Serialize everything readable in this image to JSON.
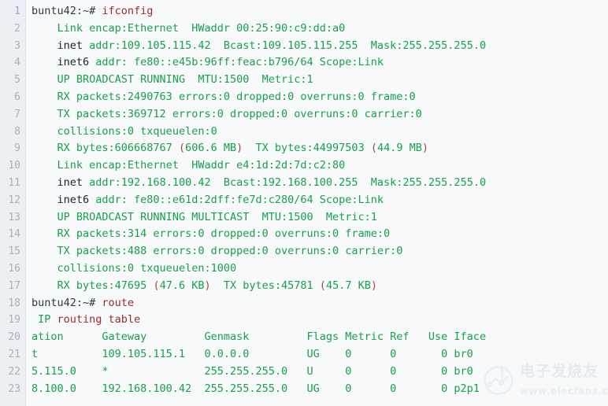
{
  "terminal": {
    "gutter_label": "line-numbers",
    "first_line_number": 1,
    "last_line_number": 23,
    "colors": {
      "background": "#f7f9fa",
      "gutter_background": "#eceff4",
      "line_number": "#a9b1ba",
      "output_green": "#19a04b",
      "keyword_dark": "#16242e",
      "command_red": "#9c2a2a",
      "paren_red": "#9c4a3a"
    },
    "lines": [
      {
        "n": 1,
        "tokens": [
          {
            "t": "buntu42:~# ",
            "c": "pr"
          },
          {
            "t": "ifconfig",
            "c": "cmd"
          }
        ]
      },
      {
        "n": 2,
        "tokens": [
          {
            "t": "    ",
            "c": "g"
          },
          {
            "t": "Link encap:Ethernet  HWaddr 00:25:90:c9:dd:a0",
            "c": "g"
          }
        ]
      },
      {
        "n": 3,
        "tokens": [
          {
            "t": "    ",
            "c": "g"
          },
          {
            "t": "inet",
            "c": "dk"
          },
          {
            "t": " addr:109.105.115.42  Bcast:109.105.115.255  Mask:255.255.255.0",
            "c": "g"
          }
        ]
      },
      {
        "n": 4,
        "tokens": [
          {
            "t": "    ",
            "c": "g"
          },
          {
            "t": "inet6",
            "c": "dk"
          },
          {
            "t": " addr: fe80::e45b:96ff:feac:b796/64 Scope:Link",
            "c": "g"
          }
        ]
      },
      {
        "n": 5,
        "tokens": [
          {
            "t": "    ",
            "c": "g"
          },
          {
            "t": "UP BROADCAST RUNNING  MTU:1500  Metric:1",
            "c": "g"
          }
        ]
      },
      {
        "n": 6,
        "tokens": [
          {
            "t": "    ",
            "c": "g"
          },
          {
            "t": "RX packets:2490763 errors:0 dropped:0 overruns:0 frame:0",
            "c": "g"
          }
        ]
      },
      {
        "n": 7,
        "tokens": [
          {
            "t": "    ",
            "c": "g"
          },
          {
            "t": "TX packets:369712 errors:0 dropped:0 overruns:0 carrier:0",
            "c": "g"
          }
        ]
      },
      {
        "n": 8,
        "tokens": [
          {
            "t": "    ",
            "c": "g"
          },
          {
            "t": "collisions:0 txqueuelen:0",
            "c": "g"
          }
        ]
      },
      {
        "n": 9,
        "tokens": [
          {
            "t": "    ",
            "c": "g"
          },
          {
            "t": "RX bytes:606668767 ",
            "c": "g"
          },
          {
            "t": "(",
            "c": "pn"
          },
          {
            "t": "606.6 MB",
            "c": "g"
          },
          {
            "t": ")",
            "c": "pn"
          },
          {
            "t": "  TX bytes:44997503 ",
            "c": "g"
          },
          {
            "t": "(",
            "c": "pn"
          },
          {
            "t": "44.9 MB",
            "c": "g"
          },
          {
            "t": ")",
            "c": "pn"
          }
        ]
      },
      {
        "n": 10,
        "tokens": [
          {
            "t": "    ",
            "c": "g"
          },
          {
            "t": "Link encap:Ethernet  HWaddr e4:1d:2d:7d:c2:80",
            "c": "g"
          }
        ]
      },
      {
        "n": 11,
        "tokens": [
          {
            "t": "    ",
            "c": "g"
          },
          {
            "t": "inet",
            "c": "dk"
          },
          {
            "t": " addr:192.168.100.42  Bcast:192.168.100.255  Mask:255.255.255.0",
            "c": "g"
          }
        ]
      },
      {
        "n": 12,
        "tokens": [
          {
            "t": "    ",
            "c": "g"
          },
          {
            "t": "inet6",
            "c": "dk"
          },
          {
            "t": " addr: fe80::e61d:2dff:fe7d:c280/64 Scope:Link",
            "c": "g"
          }
        ]
      },
      {
        "n": 13,
        "tokens": [
          {
            "t": "    ",
            "c": "g"
          },
          {
            "t": "UP BROADCAST RUNNING MULTICAST  MTU:1500  Metric:1",
            "c": "g"
          }
        ]
      },
      {
        "n": 14,
        "tokens": [
          {
            "t": "    ",
            "c": "g"
          },
          {
            "t": "RX packets:314 errors:0 dropped:0 overruns:0 frame:0",
            "c": "g"
          }
        ]
      },
      {
        "n": 15,
        "tokens": [
          {
            "t": "    ",
            "c": "g"
          },
          {
            "t": "TX packets:488 errors:0 dropped:0 overruns:0 carrier:0",
            "c": "g"
          }
        ]
      },
      {
        "n": 16,
        "tokens": [
          {
            "t": "    ",
            "c": "g"
          },
          {
            "t": "collisions:0 txqueuelen:1000",
            "c": "g"
          }
        ]
      },
      {
        "n": 17,
        "tokens": [
          {
            "t": "    ",
            "c": "g"
          },
          {
            "t": "RX bytes:47695 ",
            "c": "g"
          },
          {
            "t": "(",
            "c": "pn"
          },
          {
            "t": "47.6 KB",
            "c": "g"
          },
          {
            "t": ")",
            "c": "pn"
          },
          {
            "t": "  TX bytes:45781 ",
            "c": "g"
          },
          {
            "t": "(",
            "c": "pn"
          },
          {
            "t": "45.7 KB",
            "c": "g"
          },
          {
            "t": ")",
            "c": "pn"
          }
        ]
      },
      {
        "n": 18,
        "tokens": [
          {
            "t": "buntu42:~# ",
            "c": "pr"
          },
          {
            "t": "route",
            "c": "cmd"
          }
        ]
      },
      {
        "n": 19,
        "tokens": [
          {
            "t": " ",
            "c": "g"
          },
          {
            "t": "IP",
            "c": "g"
          },
          {
            "t": " routing table",
            "c": "cmd"
          }
        ]
      },
      {
        "n": 20,
        "tokens": [
          {
            "t": "ation      Gateway         Genmask         Flags Metric Ref   Use Iface",
            "c": "g"
          }
        ]
      },
      {
        "n": 21,
        "tokens": [
          {
            "t": "t          109.105.115.1   0.0.0.0         UG    0      0       0 br0",
            "c": "g"
          }
        ]
      },
      {
        "n": 22,
        "tokens": [
          {
            "t": "5.115.0    *               255.255.255.0   U     0      0       0 br0",
            "c": "g"
          }
        ]
      },
      {
        "n": 23,
        "tokens": [
          {
            "t": "8.100.0    192.168.100.42  255.255.255.0   UG    0      0       0 p2p1",
            "c": "g"
          }
        ]
      }
    ]
  },
  "watermark": {
    "cn_text": "电子发烧友",
    "url_text": "www.elecfans.com"
  }
}
